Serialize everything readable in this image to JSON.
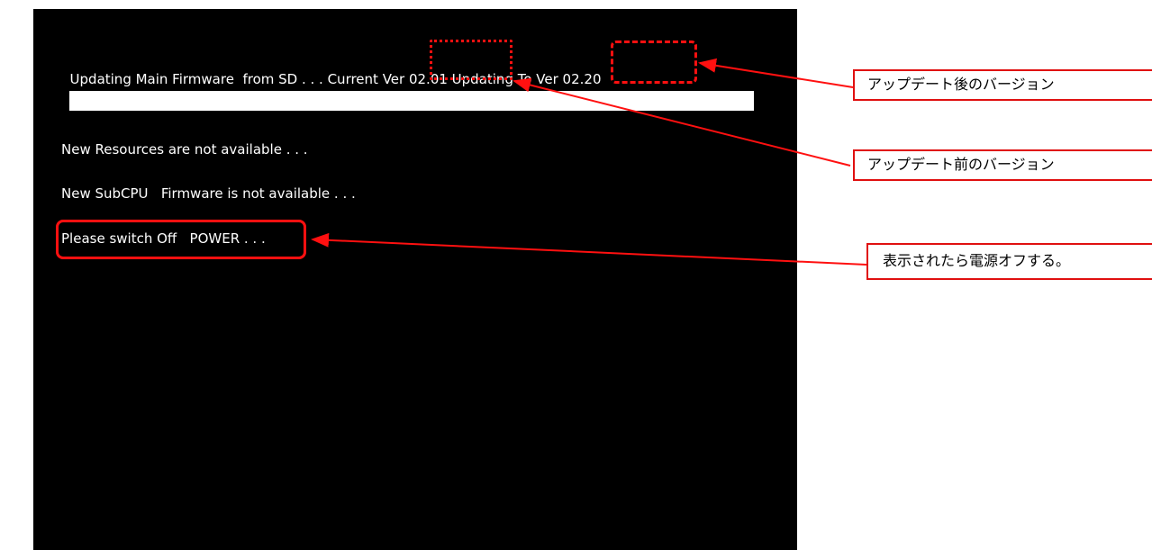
{
  "screen": {
    "line1": {
      "prefix": "Updating Main Firmware  from SD . . . Current ",
      "current_version": "Ver 02.01",
      "middle": " Updating To ",
      "target_version": "Ver 02.20"
    },
    "progress_percent": 100,
    "line2": "New Resources are not available . . .",
    "line3": "New SubCPU   Firmware is not available . . .",
    "line4": "Please switch Off   POWER . . ."
  },
  "annotations": {
    "after_version": "アップデート後のバージョン",
    "before_version": "アップデート前のバージョン",
    "power_off": "表示されたら電源オフする。"
  },
  "colors": {
    "screen_bg": "#000000",
    "screen_text": "#ffffff",
    "annotation": "#ff1010"
  }
}
